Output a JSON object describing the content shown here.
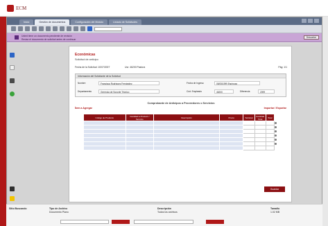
{
  "app": {
    "logo_text": "ECM"
  },
  "browser": {
    "tabs": [
      {
        "label": "Inicio"
      },
      {
        "label": "Gestión de documentos"
      },
      {
        "label": "Configuración del Módulo"
      },
      {
        "label": "Listado de Solicitudes"
      }
    ]
  },
  "notice": {
    "line1": "Usted tiene un documento pendiente de revisión",
    "line2": "Revise el documento de solicitud antes de continuar",
    "button": "Descartar"
  },
  "document": {
    "title": "Económicas",
    "subtitle": "Solicitud de anticipo",
    "meta_date": "Fecha de la Solicitud: 10/07/2007",
    "meta_user": "Usr: 46200 Pastora",
    "meta_page": "Pág: 1/1",
    "box_header": "Información del Solicitante de la Solicitud",
    "fields": [
      {
        "label": "Nombre",
        "value": "Francisca Rodríguez Fernández"
      },
      {
        "label": "Fecha de Ingreso",
        "value": "05/05/1999 Espinoza"
      },
      {
        "label": "Departamento",
        "value": "Gerencia de Soporte Técnico"
      },
      {
        "label": "Cód. Empleado",
        "value": "46200"
      },
      {
        "label": "Diferencia",
        "value": "2099"
      }
    ],
    "section_title": "Comprobante de Anticipos a Proveedores o Servicios",
    "add_link": "Ítem a Agregar",
    "export_link": "Importar / Exportar",
    "table_headers": [
      "Código de Producto",
      "Cantidad a Producir / Servicio",
      "Descripción",
      "Precio",
      "Subtotal",
      "Cantidad Total",
      "Total"
    ],
    "save_button": "Guardar"
  },
  "footer": {
    "col1_title": "Sitio Buscando",
    "col2_title": "Tipo de Archivo",
    "col2_value": "Documento Plano",
    "col3_title": "Descripción",
    "col3_value": "Todos los archivos",
    "col4_title": "Tamaño",
    "col4_value": "1.02 MB"
  }
}
